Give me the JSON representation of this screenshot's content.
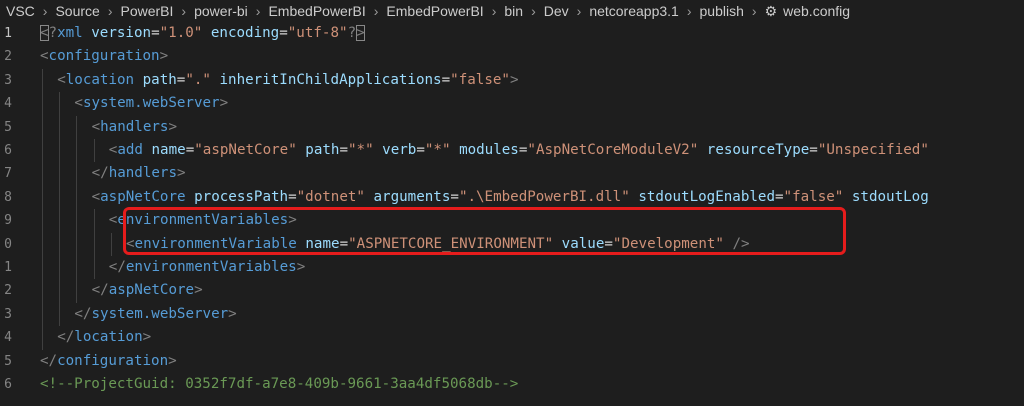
{
  "breadcrumb": {
    "items": [
      "VSC",
      "Source",
      "PowerBI",
      "power-bi",
      "EmbedPowerBI",
      "EmbedPowerBI",
      "bin",
      "Dev",
      "netcoreapp3.1",
      "publish"
    ],
    "file": "web.config",
    "file_icon": "gear-icon"
  },
  "editor": {
    "line_numbers": [
      "1",
      "2",
      "3",
      "4",
      "5",
      "6",
      "7",
      "8",
      "9",
      "0",
      "1",
      "2",
      "3",
      "4",
      "5",
      "6"
    ],
    "lines": [
      [
        [
          "punct",
          "<"
        ],
        [
          "punct",
          "?"
        ],
        [
          "tag",
          "xml"
        ],
        [
          "text",
          " "
        ],
        [
          "attr",
          "version"
        ],
        [
          "eq",
          "="
        ],
        [
          "str",
          "\"1.0\""
        ],
        [
          "text",
          " "
        ],
        [
          "attr",
          "encoding"
        ],
        [
          "eq",
          "="
        ],
        [
          "str",
          "\"utf-8\""
        ],
        [
          "punct",
          "?"
        ],
        [
          "punct",
          ">"
        ]
      ],
      [
        [
          "punct",
          "<"
        ],
        [
          "tag",
          "configuration"
        ],
        [
          "punct",
          ">"
        ]
      ],
      [
        [
          "punct",
          "<"
        ],
        [
          "tag",
          "location"
        ],
        [
          "text",
          " "
        ],
        [
          "attr",
          "path"
        ],
        [
          "eq",
          "="
        ],
        [
          "str",
          "\".\""
        ],
        [
          "text",
          " "
        ],
        [
          "attr",
          "inheritInChildApplications"
        ],
        [
          "eq",
          "="
        ],
        [
          "str",
          "\"false\""
        ],
        [
          "punct",
          ">"
        ]
      ],
      [
        [
          "punct",
          "<"
        ],
        [
          "tag",
          "system.webServer"
        ],
        [
          "punct",
          ">"
        ]
      ],
      [
        [
          "punct",
          "<"
        ],
        [
          "tag",
          "handlers"
        ],
        [
          "punct",
          ">"
        ]
      ],
      [
        [
          "punct",
          "<"
        ],
        [
          "tag",
          "add"
        ],
        [
          "text",
          " "
        ],
        [
          "attr",
          "name"
        ],
        [
          "eq",
          "="
        ],
        [
          "str",
          "\"aspNetCore\""
        ],
        [
          "text",
          " "
        ],
        [
          "attr",
          "path"
        ],
        [
          "eq",
          "="
        ],
        [
          "str",
          "\"*\""
        ],
        [
          "text",
          " "
        ],
        [
          "attr",
          "verb"
        ],
        [
          "eq",
          "="
        ],
        [
          "str",
          "\"*\""
        ],
        [
          "text",
          " "
        ],
        [
          "attr",
          "modules"
        ],
        [
          "eq",
          "="
        ],
        [
          "str",
          "\"AspNetCoreModuleV2\""
        ],
        [
          "text",
          " "
        ],
        [
          "attr",
          "resourceType"
        ],
        [
          "eq",
          "="
        ],
        [
          "str",
          "\"Unspecified\""
        ]
      ],
      [
        [
          "punct",
          "</"
        ],
        [
          "tag",
          "handlers"
        ],
        [
          "punct",
          ">"
        ]
      ],
      [
        [
          "punct",
          "<"
        ],
        [
          "tag",
          "aspNetCore"
        ],
        [
          "text",
          " "
        ],
        [
          "attr",
          "processPath"
        ],
        [
          "eq",
          "="
        ],
        [
          "str",
          "\"dotnet\""
        ],
        [
          "text",
          " "
        ],
        [
          "attr",
          "arguments"
        ],
        [
          "eq",
          "="
        ],
        [
          "str",
          "\".\\EmbedPowerBI.dll\""
        ],
        [
          "text",
          " "
        ],
        [
          "attr",
          "stdoutLogEnabled"
        ],
        [
          "eq",
          "="
        ],
        [
          "str",
          "\"false\""
        ],
        [
          "text",
          " "
        ],
        [
          "attr",
          "stdoutLog"
        ]
      ],
      [
        [
          "punct",
          "<"
        ],
        [
          "tag",
          "environmentVariables"
        ],
        [
          "punct",
          ">"
        ]
      ],
      [
        [
          "punct",
          "<"
        ],
        [
          "tag",
          "environmentVariable"
        ],
        [
          "text",
          " "
        ],
        [
          "attr",
          "name"
        ],
        [
          "eq",
          "="
        ],
        [
          "str",
          "\"ASPNETCORE_ENVIRONMENT\""
        ],
        [
          "text",
          " "
        ],
        [
          "attr",
          "value"
        ],
        [
          "eq",
          "="
        ],
        [
          "str",
          "\"Development\""
        ],
        [
          "text",
          " "
        ],
        [
          "punct",
          "/>"
        ]
      ],
      [
        [
          "punct",
          "</"
        ],
        [
          "tag",
          "environmentVariables"
        ],
        [
          "punct",
          ">"
        ]
      ],
      [
        [
          "punct",
          "</"
        ],
        [
          "tag",
          "aspNetCore"
        ],
        [
          "punct",
          ">"
        ]
      ],
      [
        [
          "punct",
          "</"
        ],
        [
          "tag",
          "system.webServer"
        ],
        [
          "punct",
          ">"
        ]
      ],
      [
        [
          "punct",
          "</"
        ],
        [
          "tag",
          "location"
        ],
        [
          "punct",
          ">"
        ]
      ],
      [
        [
          "punct",
          "</"
        ],
        [
          "tag",
          "configuration"
        ],
        [
          "punct",
          ">"
        ]
      ],
      [
        [
          "comment",
          "<!--ProjectGuid: 0352f7df-a7e8-409b-9661-3aa4df5068db-->"
        ]
      ]
    ]
  },
  "colors": {
    "background": "#1e1e1e",
    "tag": "#569cd6",
    "attribute": "#9cdcfe",
    "string": "#ce9178",
    "punctuation": "#808080",
    "comment": "#6a9955",
    "highlight_box": "#e51c1c"
  }
}
